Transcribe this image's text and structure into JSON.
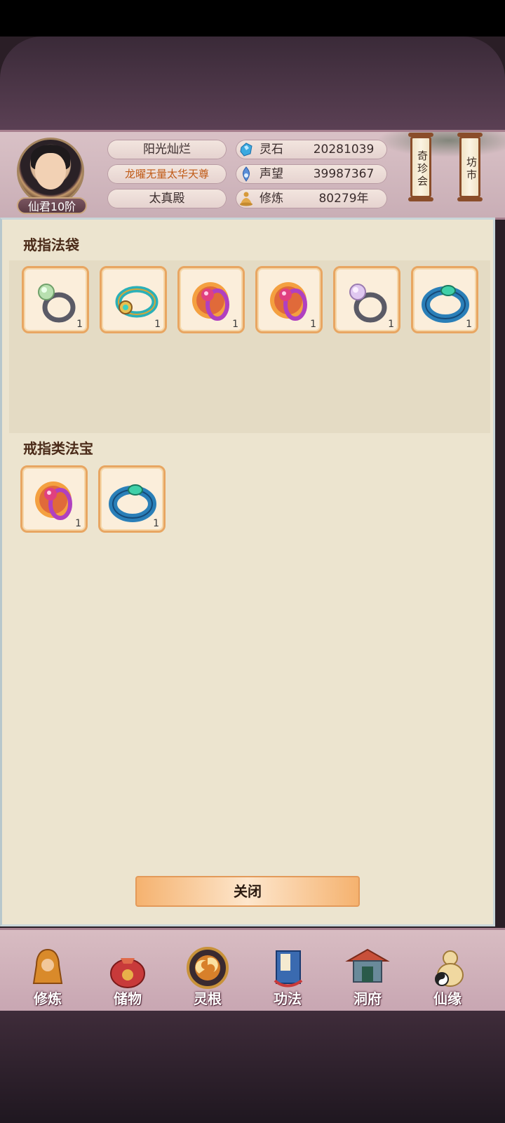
{
  "player": {
    "name": "阳光灿烂",
    "title": "龙曜无量太华天尊",
    "sect": "太真殿",
    "rank": "仙君10阶"
  },
  "stats": [
    {
      "icon": "spirit-stone-icon",
      "label": "灵石",
      "value": "20281039"
    },
    {
      "icon": "reputation-icon",
      "label": "声望",
      "value": "39987367"
    },
    {
      "icon": "cultivation-icon",
      "label": "修炼",
      "value": "80279年"
    }
  ],
  "shortcuts": {
    "treasure_fair": "奇珍会",
    "market": "坊市"
  },
  "sections": [
    {
      "title": "戒指法袋",
      "items": [
        {
          "icon": "jade-ring-icon",
          "count": "1"
        },
        {
          "icon": "gold-turquoise-ring-icon",
          "count": "1"
        },
        {
          "icon": "flame-ring-icon",
          "count": "1"
        },
        {
          "icon": "flame-ring-icon",
          "count": "1"
        },
        {
          "icon": "pearl-ring-icon",
          "count": "1"
        },
        {
          "icon": "azure-jade-ring-icon",
          "count": "1"
        }
      ]
    },
    {
      "title": "戒指类法宝",
      "items": [
        {
          "icon": "flame-ring-icon",
          "count": "1"
        },
        {
          "icon": "azure-jade-ring-icon",
          "count": "1"
        }
      ]
    }
  ],
  "close_label": "关闭",
  "nav": [
    {
      "icon": "cultivate-icon",
      "label": "修炼"
    },
    {
      "icon": "storage-bag-icon",
      "label": "储物"
    },
    {
      "icon": "spirit-root-icon",
      "label": "灵根"
    },
    {
      "icon": "technique-book-icon",
      "label": "功法"
    },
    {
      "icon": "cave-dwelling-icon",
      "label": "洞府"
    },
    {
      "icon": "destiny-gourd-icon",
      "label": "仙缘"
    }
  ],
  "colors": {
    "slot_border": "#e8a662",
    "title_accent": "#c05a16",
    "panel_bg": "#ece4cf"
  }
}
